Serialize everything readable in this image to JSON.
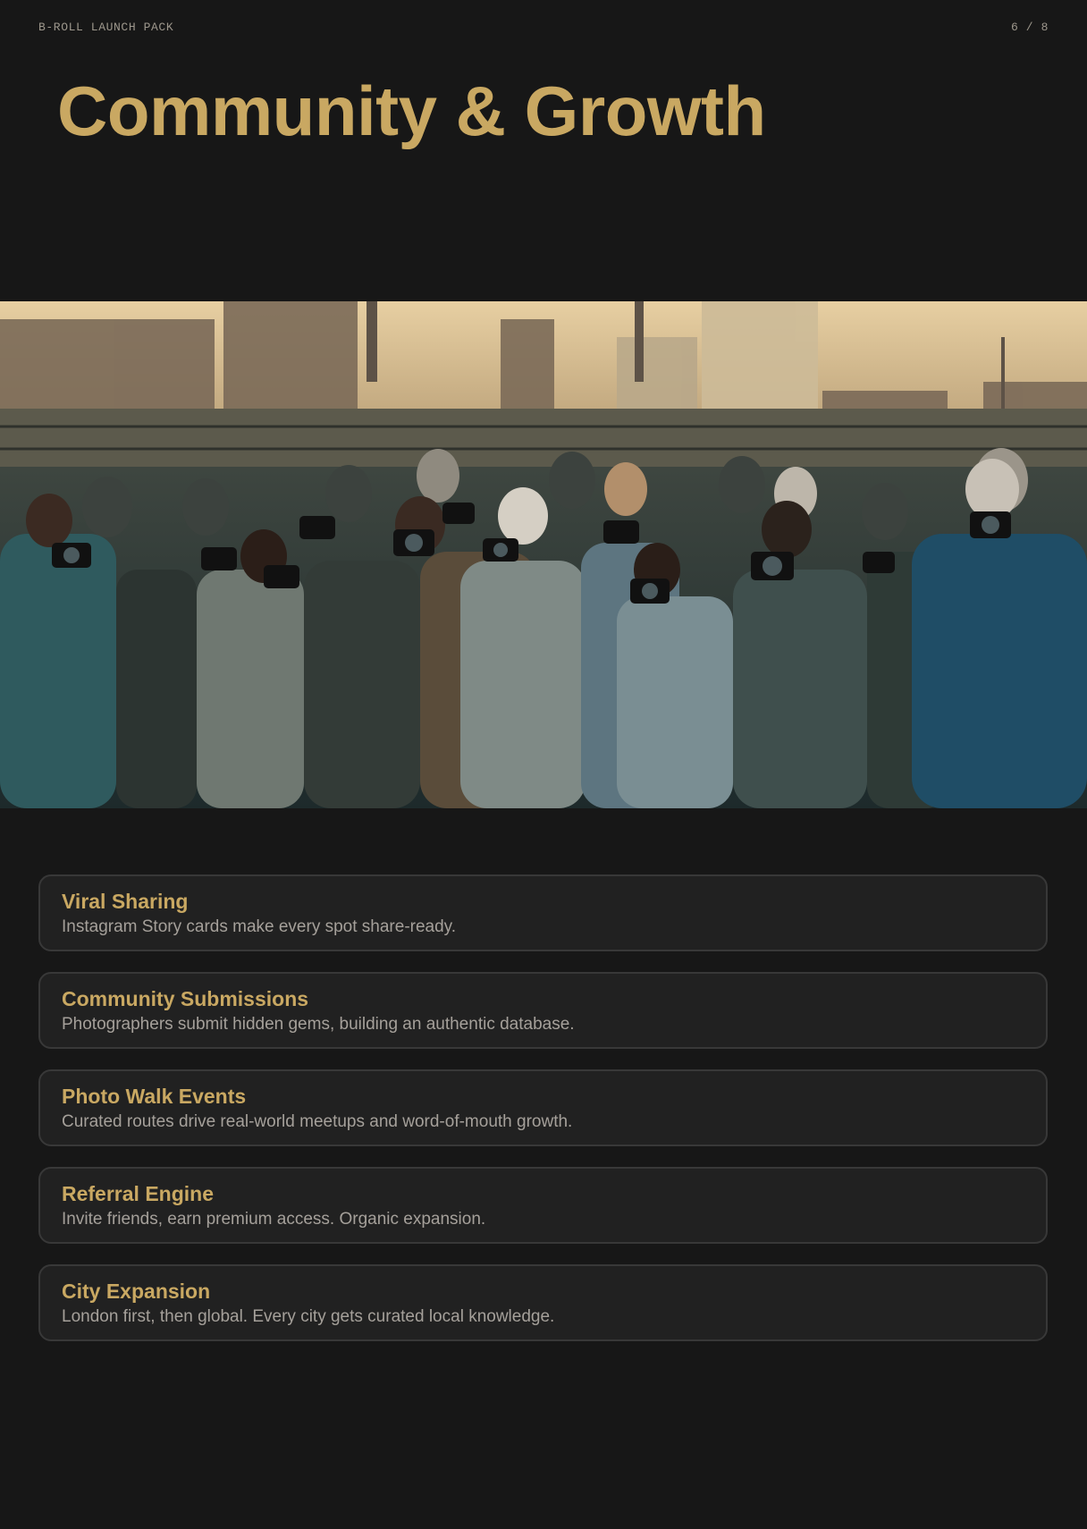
{
  "header": {
    "brand": "B-ROLL LAUNCH PACK",
    "page_indicator": "6 / 8"
  },
  "title": "Community & Growth",
  "hero_image": {
    "icon": "photo-crowd-photographers-image"
  },
  "colors": {
    "accent": "#c9a862",
    "background": "#171717",
    "card_bg": "#212121",
    "card_border": "#383838",
    "muted_text": "#a5a09a"
  },
  "cards": [
    {
      "title": "Viral Sharing",
      "description": "Instagram Story cards make every spot share-ready."
    },
    {
      "title": "Community Submissions",
      "description": "Photographers submit hidden gems, building an authentic database."
    },
    {
      "title": "Photo Walk Events",
      "description": "Curated routes drive real-world meetups and word-of-mouth growth."
    },
    {
      "title": "Referral Engine",
      "description": "Invite friends, earn premium access. Organic expansion."
    },
    {
      "title": "City Expansion",
      "description": "London first, then global. Every city gets curated local knowledge."
    }
  ]
}
